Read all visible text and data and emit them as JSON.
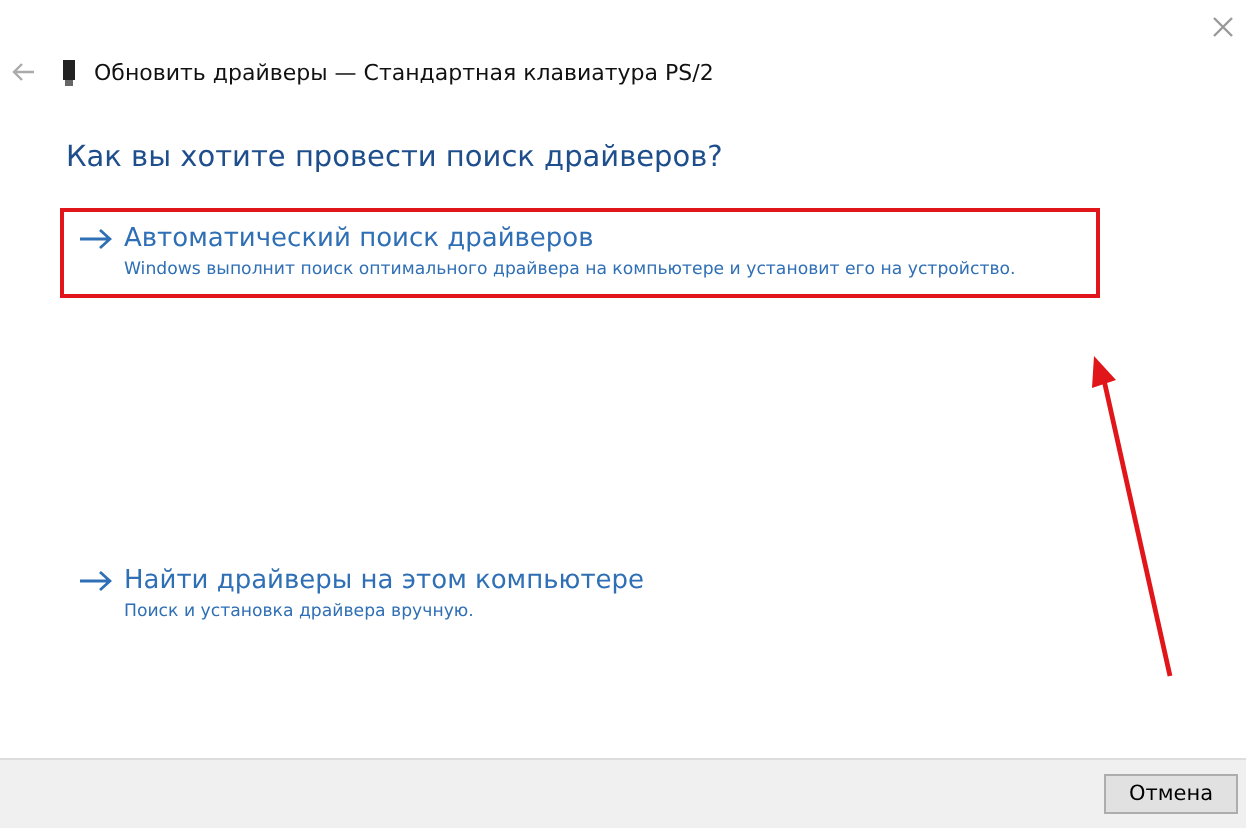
{
  "window": {
    "title": "Обновить драйверы — Стандартная клавиатура PS/2"
  },
  "heading": "Как вы хотите провести поиск драйверов?",
  "options": [
    {
      "title": "Автоматический поиск драйверов",
      "description": "Windows выполнит поиск оптимального драйвера на компьютере и установит его на устройство.",
      "highlighted": true
    },
    {
      "title": "Найти драйверы на этом компьютере",
      "description": "Поиск и установка драйвера вручную.",
      "highlighted": false
    }
  ],
  "buttons": [
    "Отмена"
  ]
}
